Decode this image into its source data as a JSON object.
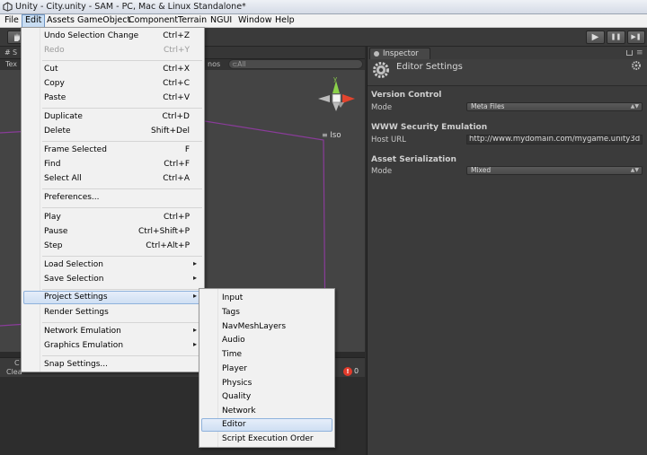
{
  "window": {
    "title": "Unity - City.unity - SAM - PC, Mac & Linux Standalone*"
  },
  "menubar": [
    "File",
    "Edit",
    "Assets",
    "GameObject",
    "Component",
    "Terrain",
    "NGUI",
    "Window",
    "Help"
  ],
  "toolbar": {
    "play": "▶",
    "pause": "❚❚",
    "step": "▶❚"
  },
  "scene": {
    "tab_fragment": "S",
    "sub_fragment": "Tex",
    "gizmos_fragment": "nos",
    "search_placeholder": "⊂All",
    "gizmo_y": "y",
    "iso_label": "Iso"
  },
  "console": {
    "tab_fragment": "C",
    "clear_fragment": "Clea",
    "error_count": "0",
    "error_glyph": "!"
  },
  "inspector": {
    "tab_label": "Inspector",
    "title": "Editor Settings",
    "version_control": {
      "title": "Version Control",
      "mode_label": "Mode",
      "mode_value": "Meta Files"
    },
    "www_security": {
      "title": "WWW Security Emulation",
      "host_label": "Host URL",
      "host_value": "http://www.mydomain.com/mygame.unity3d"
    },
    "asset_serialization": {
      "title": "Asset Serialization",
      "mode_label": "Mode",
      "mode_value": "Mixed"
    }
  },
  "edit_menu": {
    "items": [
      {
        "label": "Undo Selection Change",
        "shortcut": "Ctrl+Z"
      },
      {
        "label": "Redo",
        "shortcut": "Ctrl+Y"
      },
      {
        "label": "Cut",
        "shortcut": "Ctrl+X"
      },
      {
        "label": "Copy",
        "shortcut": "Ctrl+C"
      },
      {
        "label": "Paste",
        "shortcut": "Ctrl+V"
      },
      {
        "label": "Duplicate",
        "shortcut": "Ctrl+D"
      },
      {
        "label": "Delete",
        "shortcut": "Shift+Del"
      },
      {
        "label": "Frame Selected",
        "shortcut": "F"
      },
      {
        "label": "Find",
        "shortcut": "Ctrl+F"
      },
      {
        "label": "Select All",
        "shortcut": "Ctrl+A"
      },
      {
        "label": "Preferences...",
        "shortcut": ""
      },
      {
        "label": "Play",
        "shortcut": "Ctrl+P"
      },
      {
        "label": "Pause",
        "shortcut": "Ctrl+Shift+P"
      },
      {
        "label": "Step",
        "shortcut": "Ctrl+Alt+P"
      },
      {
        "label": "Load Selection",
        "shortcut": ""
      },
      {
        "label": "Save Selection",
        "shortcut": ""
      },
      {
        "label": "Project Settings",
        "shortcut": ""
      },
      {
        "label": "Render Settings",
        "shortcut": ""
      },
      {
        "label": "Network Emulation",
        "shortcut": ""
      },
      {
        "label": "Graphics Emulation",
        "shortcut": ""
      },
      {
        "label": "Snap Settings...",
        "shortcut": ""
      }
    ],
    "submenu_arrow": "▸"
  },
  "project_settings_menu": [
    "Input",
    "Tags",
    "NavMeshLayers",
    "Audio",
    "Time",
    "Player",
    "Physics",
    "Quality",
    "Network",
    "Editor",
    "Script Execution Order"
  ]
}
